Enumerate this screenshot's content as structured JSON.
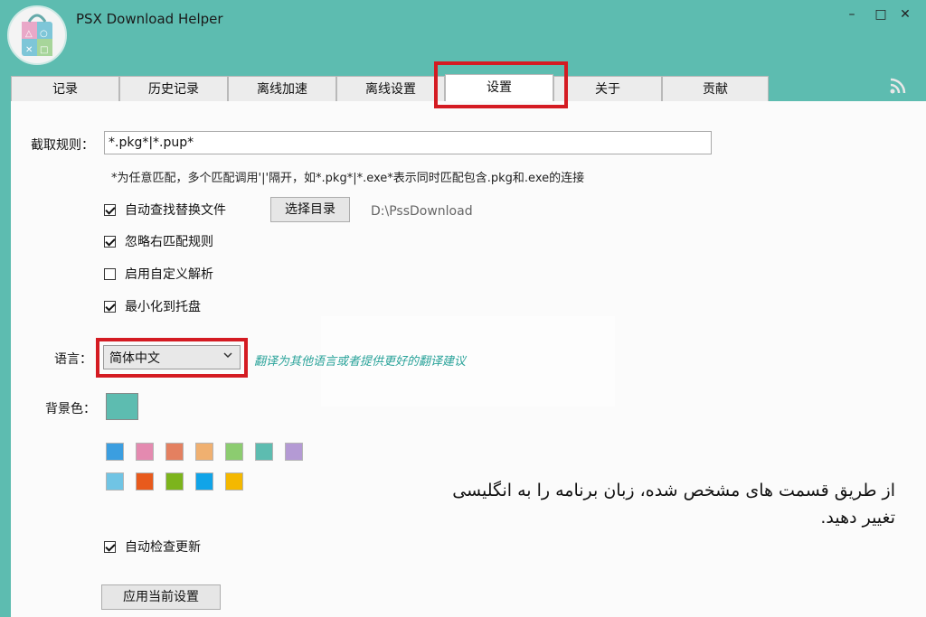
{
  "app": {
    "title": "PSX Download Helper"
  },
  "window_controls": {
    "minimize": "–",
    "maximize": "□",
    "close": "✕"
  },
  "tabs": [
    {
      "label": "记录"
    },
    {
      "label": "历史记录"
    },
    {
      "label": "离线加速"
    },
    {
      "label": "离线设置"
    },
    {
      "label": "设置",
      "active": true
    },
    {
      "label": "关于"
    },
    {
      "label": "贡献"
    }
  ],
  "settings": {
    "capture_rule_label": "截取规则：",
    "capture_rule_value": "*.pkg*|*.pup*",
    "capture_rule_hint": "*为任意匹配，多个匹配调用'|'隔开，如*.pkg*|*.exe*表示同时匹配包含.pkg和.exe的连接",
    "auto_find_label": "自动查找替换文件",
    "auto_find_checked": true,
    "choose_dir_button": "选择目录",
    "download_path": "D:\\PssDownload",
    "ignore_right_label": "忽略右匹配规则",
    "ignore_right_checked": true,
    "custom_parse_label": "启用自定义解析",
    "custom_parse_checked": false,
    "minimize_tray_label": "最小化到托盘",
    "minimize_tray_checked": true,
    "language_label": "语言：",
    "language_value": "简体中文",
    "translate_link": "翻译为其他语言或者提供更好的翻译建议",
    "bg_color_label": "背景色：",
    "bg_color_current": "#5dbcb0",
    "palette_row1": [
      "#3b9ee0",
      "#e48ab0",
      "#e48060",
      "#f0b070",
      "#8ccc70",
      "#5dbcb0",
      "#b49ad4"
    ],
    "palette_row2": [
      "#70c4e4",
      "#e85a1c",
      "#7cb41c",
      "#10a4e8",
      "#f4b800"
    ],
    "auto_update_label": "自动检查更新",
    "auto_update_checked": true,
    "apply_button": "应用当前设置"
  },
  "annotation": {
    "text_line1": "از طریق قسمت های مشخص شده، زبان برنامه را به انگلیسی",
    "text_line2": "تغییر دهید.",
    "highlight_color": "#d41b22"
  }
}
